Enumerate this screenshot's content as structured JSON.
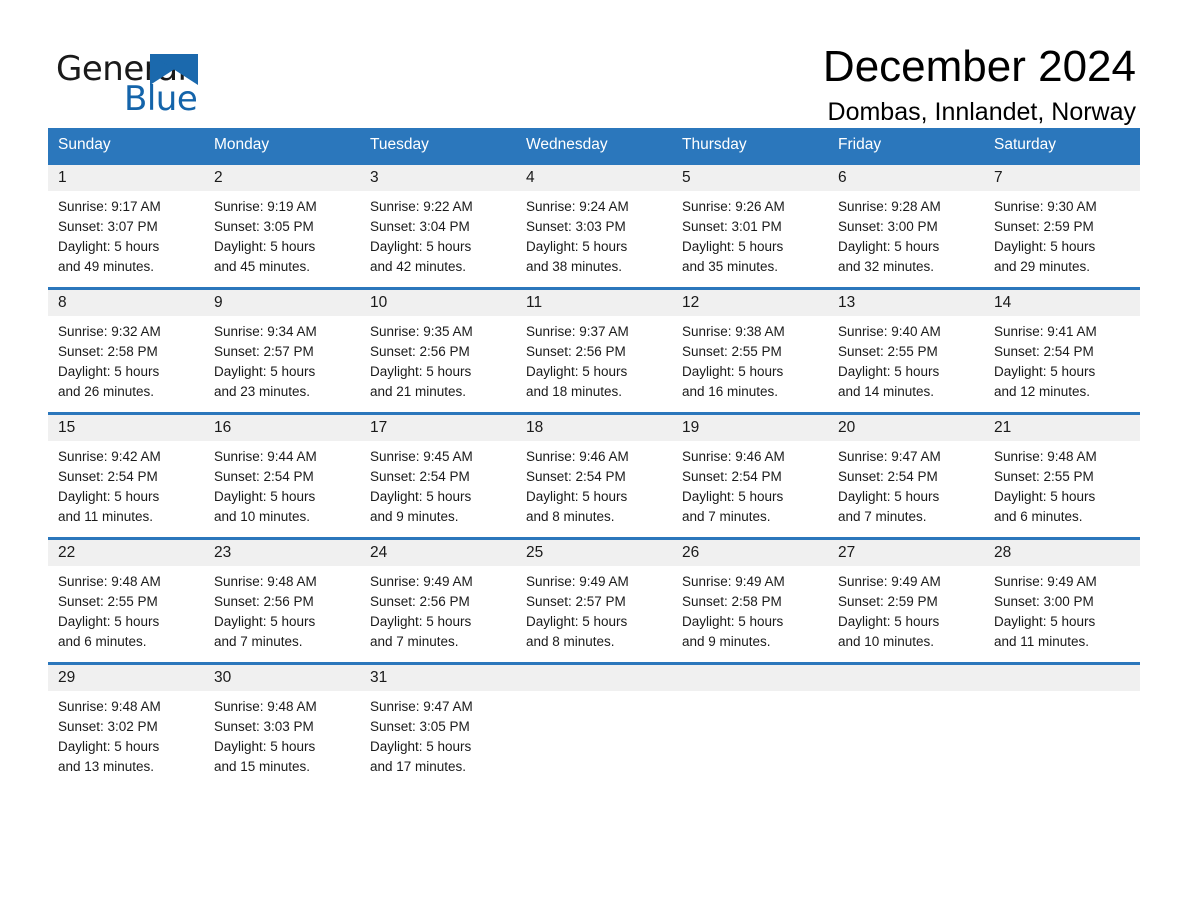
{
  "brand": {
    "word_one": "General",
    "word_two": "Blue",
    "triangle_color": "#1b69ad",
    "text_color": "#1a1a1a",
    "blue_color": "#1464aa"
  },
  "header": {
    "title": "December 2024",
    "subtitle": "Dombas, Innlandet, Norway"
  },
  "theme": {
    "header_blue": "#2b77bc",
    "daynum_band": "#f0f0f0",
    "cell_bg": "#ffffff",
    "text": "#1a1a1a"
  },
  "weekdays": [
    "Sunday",
    "Monday",
    "Tuesday",
    "Wednesday",
    "Thursday",
    "Friday",
    "Saturday"
  ],
  "weeks": [
    {
      "days": [
        {
          "num": "1",
          "l1": "Sunrise: 9:17 AM",
          "l2": "Sunset: 3:07 PM",
          "l3": "Daylight: 5 hours",
          "l4": "and 49 minutes."
        },
        {
          "num": "2",
          "l1": "Sunrise: 9:19 AM",
          "l2": "Sunset: 3:05 PM",
          "l3": "Daylight: 5 hours",
          "l4": "and 45 minutes."
        },
        {
          "num": "3",
          "l1": "Sunrise: 9:22 AM",
          "l2": "Sunset: 3:04 PM",
          "l3": "Daylight: 5 hours",
          "l4": "and 42 minutes."
        },
        {
          "num": "4",
          "l1": "Sunrise: 9:24 AM",
          "l2": "Sunset: 3:03 PM",
          "l3": "Daylight: 5 hours",
          "l4": "and 38 minutes."
        },
        {
          "num": "5",
          "l1": "Sunrise: 9:26 AM",
          "l2": "Sunset: 3:01 PM",
          "l3": "Daylight: 5 hours",
          "l4": "and 35 minutes."
        },
        {
          "num": "6",
          "l1": "Sunrise: 9:28 AM",
          "l2": "Sunset: 3:00 PM",
          "l3": "Daylight: 5 hours",
          "l4": "and 32 minutes."
        },
        {
          "num": "7",
          "l1": "Sunrise: 9:30 AM",
          "l2": "Sunset: 2:59 PM",
          "l3": "Daylight: 5 hours",
          "l4": "and 29 minutes."
        }
      ]
    },
    {
      "days": [
        {
          "num": "8",
          "l1": "Sunrise: 9:32 AM",
          "l2": "Sunset: 2:58 PM",
          "l3": "Daylight: 5 hours",
          "l4": "and 26 minutes."
        },
        {
          "num": "9",
          "l1": "Sunrise: 9:34 AM",
          "l2": "Sunset: 2:57 PM",
          "l3": "Daylight: 5 hours",
          "l4": "and 23 minutes."
        },
        {
          "num": "10",
          "l1": "Sunrise: 9:35 AM",
          "l2": "Sunset: 2:56 PM",
          "l3": "Daylight: 5 hours",
          "l4": "and 21 minutes."
        },
        {
          "num": "11",
          "l1": "Sunrise: 9:37 AM",
          "l2": "Sunset: 2:56 PM",
          "l3": "Daylight: 5 hours",
          "l4": "and 18 minutes."
        },
        {
          "num": "12",
          "l1": "Sunrise: 9:38 AM",
          "l2": "Sunset: 2:55 PM",
          "l3": "Daylight: 5 hours",
          "l4": "and 16 minutes."
        },
        {
          "num": "13",
          "l1": "Sunrise: 9:40 AM",
          "l2": "Sunset: 2:55 PM",
          "l3": "Daylight: 5 hours",
          "l4": "and 14 minutes."
        },
        {
          "num": "14",
          "l1": "Sunrise: 9:41 AM",
          "l2": "Sunset: 2:54 PM",
          "l3": "Daylight: 5 hours",
          "l4": "and 12 minutes."
        }
      ]
    },
    {
      "days": [
        {
          "num": "15",
          "l1": "Sunrise: 9:42 AM",
          "l2": "Sunset: 2:54 PM",
          "l3": "Daylight: 5 hours",
          "l4": "and 11 minutes."
        },
        {
          "num": "16",
          "l1": "Sunrise: 9:44 AM",
          "l2": "Sunset: 2:54 PM",
          "l3": "Daylight: 5 hours",
          "l4": "and 10 minutes."
        },
        {
          "num": "17",
          "l1": "Sunrise: 9:45 AM",
          "l2": "Sunset: 2:54 PM",
          "l3": "Daylight: 5 hours",
          "l4": "and 9 minutes."
        },
        {
          "num": "18",
          "l1": "Sunrise: 9:46 AM",
          "l2": "Sunset: 2:54 PM",
          "l3": "Daylight: 5 hours",
          "l4": "and 8 minutes."
        },
        {
          "num": "19",
          "l1": "Sunrise: 9:46 AM",
          "l2": "Sunset: 2:54 PM",
          "l3": "Daylight: 5 hours",
          "l4": "and 7 minutes."
        },
        {
          "num": "20",
          "l1": "Sunrise: 9:47 AM",
          "l2": "Sunset: 2:54 PM",
          "l3": "Daylight: 5 hours",
          "l4": "and 7 minutes."
        },
        {
          "num": "21",
          "l1": "Sunrise: 9:48 AM",
          "l2": "Sunset: 2:55 PM",
          "l3": "Daylight: 5 hours",
          "l4": "and 6 minutes."
        }
      ]
    },
    {
      "days": [
        {
          "num": "22",
          "l1": "Sunrise: 9:48 AM",
          "l2": "Sunset: 2:55 PM",
          "l3": "Daylight: 5 hours",
          "l4": "and 6 minutes."
        },
        {
          "num": "23",
          "l1": "Sunrise: 9:48 AM",
          "l2": "Sunset: 2:56 PM",
          "l3": "Daylight: 5 hours",
          "l4": "and 7 minutes."
        },
        {
          "num": "24",
          "l1": "Sunrise: 9:49 AM",
          "l2": "Sunset: 2:56 PM",
          "l3": "Daylight: 5 hours",
          "l4": "and 7 minutes."
        },
        {
          "num": "25",
          "l1": "Sunrise: 9:49 AM",
          "l2": "Sunset: 2:57 PM",
          "l3": "Daylight: 5 hours",
          "l4": "and 8 minutes."
        },
        {
          "num": "26",
          "l1": "Sunrise: 9:49 AM",
          "l2": "Sunset: 2:58 PM",
          "l3": "Daylight: 5 hours",
          "l4": "and 9 minutes."
        },
        {
          "num": "27",
          "l1": "Sunrise: 9:49 AM",
          "l2": "Sunset: 2:59 PM",
          "l3": "Daylight: 5 hours",
          "l4": "and 10 minutes."
        },
        {
          "num": "28",
          "l1": "Sunrise: 9:49 AM",
          "l2": "Sunset: 3:00 PM",
          "l3": "Daylight: 5 hours",
          "l4": "and 11 minutes."
        }
      ]
    },
    {
      "days": [
        {
          "num": "29",
          "l1": "Sunrise: 9:48 AM",
          "l2": "Sunset: 3:02 PM",
          "l3": "Daylight: 5 hours",
          "l4": "and 13 minutes."
        },
        {
          "num": "30",
          "l1": "Sunrise: 9:48 AM",
          "l2": "Sunset: 3:03 PM",
          "l3": "Daylight: 5 hours",
          "l4": "and 15 minutes."
        },
        {
          "num": "31",
          "l1": "Sunrise: 9:47 AM",
          "l2": "Sunset: 3:05 PM",
          "l3": "Daylight: 5 hours",
          "l4": "and 17 minutes."
        },
        {
          "num": "",
          "l1": "",
          "l2": "",
          "l3": "",
          "l4": ""
        },
        {
          "num": "",
          "l1": "",
          "l2": "",
          "l3": "",
          "l4": ""
        },
        {
          "num": "",
          "l1": "",
          "l2": "",
          "l3": "",
          "l4": ""
        },
        {
          "num": "",
          "l1": "",
          "l2": "",
          "l3": "",
          "l4": ""
        }
      ]
    }
  ]
}
